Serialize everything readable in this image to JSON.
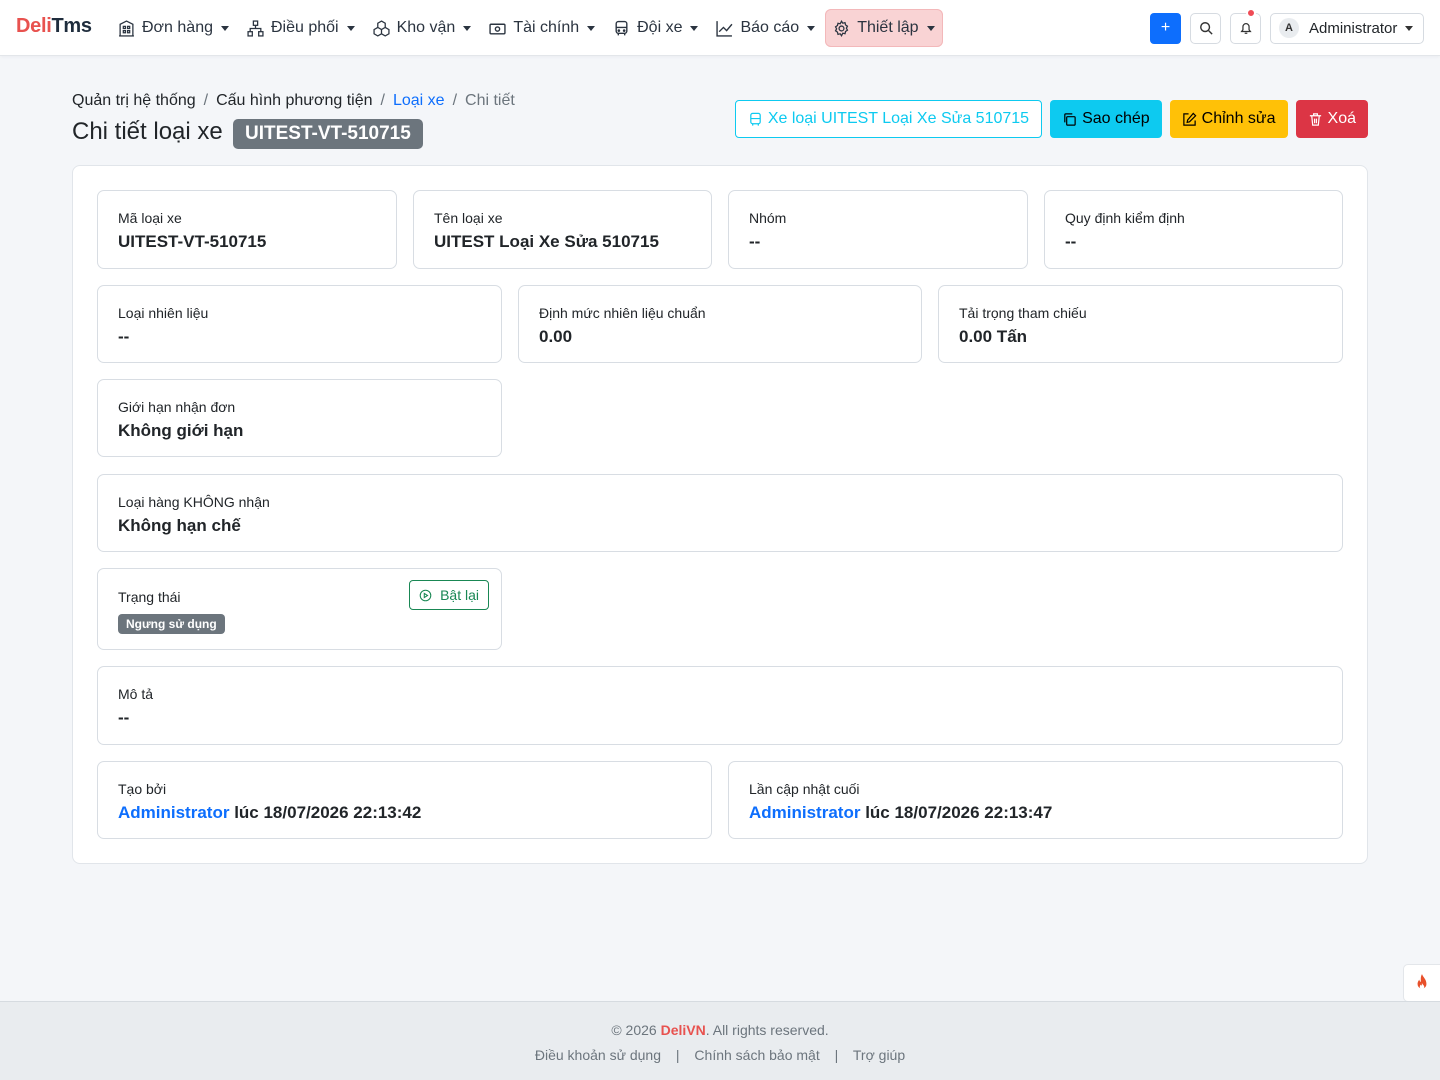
{
  "brand": {
    "part1": "Deli",
    "part2": "Tms"
  },
  "nav": {
    "items": [
      {
        "label": "Đơn hàng",
        "icon": "building-icon"
      },
      {
        "label": "Điều phối",
        "icon": "hierarchy-icon"
      },
      {
        "label": "Kho vận",
        "icon": "boxes-icon"
      },
      {
        "label": "Tài chính",
        "icon": "cash-icon"
      },
      {
        "label": "Đội xe",
        "icon": "bus-icon"
      },
      {
        "label": "Báo cáo",
        "icon": "graph-icon"
      },
      {
        "label": "Thiết lập",
        "icon": "gear-icon",
        "active": true
      }
    ],
    "user": {
      "initial": "A",
      "name": "Administrator"
    },
    "plus_label": "+"
  },
  "breadcrumb": {
    "items": [
      "Quản trị hệ thống",
      "Cấu hình phương tiện",
      "Loại xe",
      "Chi tiết"
    ],
    "sep": "/"
  },
  "page": {
    "title": "Chi tiết loại xe",
    "code": "UITEST-VT-510715"
  },
  "actions": {
    "vehicles": "Xe loại UITEST Loại Xe Sửa 510715",
    "copy": "Sao chép",
    "edit": "Chỉnh sửa",
    "delete": "Xoá"
  },
  "fields": {
    "code": {
      "label": "Mã loại xe",
      "value": "UITEST-VT-510715"
    },
    "name": {
      "label": "Tên loại xe",
      "value": "UITEST Loại Xe Sửa 510715"
    },
    "group": {
      "label": "Nhóm",
      "value": "--"
    },
    "inspection": {
      "label": "Quy định kiểm định",
      "value": "--"
    },
    "fuel_type": {
      "label": "Loại nhiên liệu",
      "value": "--"
    },
    "fuel_norm": {
      "label": "Định mức nhiên liệu chuẩn",
      "value": "0.00"
    },
    "payload": {
      "label": "Tải trọng tham chiếu",
      "value": "0.00 Tấn"
    },
    "order_limit": {
      "label": "Giới hạn nhận đơn",
      "value": "Không giới hạn"
    },
    "excluded_goods": {
      "label": "Loại hàng KHÔNG nhận",
      "value": "Không hạn chế"
    },
    "status": {
      "label": "Trạng thái",
      "value": "Ngưng sử dụng",
      "button": "Bật lại"
    },
    "description": {
      "label": "Mô tả",
      "value": "--"
    },
    "created": {
      "label": "Tạo bởi",
      "user": "Administrator",
      "rest": " lúc 18/07/2026 22:13:42"
    },
    "updated": {
      "label": "Lần cập nhật cuối",
      "user": "Administrator",
      "rest": " lúc 18/07/2026 22:13:47"
    }
  },
  "footer": {
    "copy_pre": "© 2026 ",
    "copy_brand": "DeliVN",
    "copy_post": ". All rights reserved.",
    "links": [
      "Điều khoản sử dụng",
      "Chính sách bảo mật",
      "Trợ giúp"
    ],
    "pipe": "|"
  },
  "colors": {
    "brand_red": "#e8524f",
    "primary": "#0d6efd",
    "info": "#0dcaf0",
    "warning": "#ffc107",
    "danger": "#dc3545",
    "success": "#198754",
    "secondary": "#6c757d"
  }
}
